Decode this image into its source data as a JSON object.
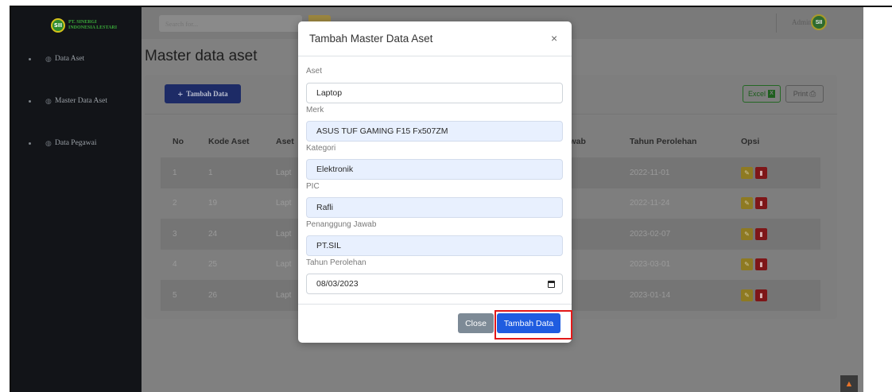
{
  "brand": {
    "logo": "SII",
    "line1": "PT. SINERGI",
    "line2": "INDONESIA LESTARI"
  },
  "sidebar": {
    "items": [
      {
        "label": "Data Aset",
        "icon": "palette-icon"
      },
      {
        "label": "Master Data Aset",
        "icon": "palette-icon"
      },
      {
        "label": "Data Pegawai",
        "icon": "palette-icon"
      }
    ]
  },
  "topbar": {
    "search_placeholder": "Search for...",
    "user_name": "Admin",
    "avatar": "SII"
  },
  "page": {
    "title": "Master data aset"
  },
  "toolbar": {
    "add_label": "Tambah Data",
    "excel_label": "Excel",
    "print_label": "Print"
  },
  "table": {
    "headers": [
      "No",
      "Kode Aset",
      "Aset",
      "ng jawab",
      "Tahun Perolehan",
      "Opsi"
    ],
    "rows": [
      {
        "no": "1",
        "kode": "1",
        "aset": "Lapt",
        "tahun": "2022-11-01"
      },
      {
        "no": "2",
        "kode": "19",
        "aset": "Lapt",
        "tahun": "2022-11-24"
      },
      {
        "no": "3",
        "kode": "24",
        "aset": "Lapt",
        "tahun": "2023-02-07"
      },
      {
        "no": "4",
        "kode": "25",
        "aset": "Lapt",
        "tahun": "2023-03-01"
      },
      {
        "no": "5",
        "kode": "26",
        "aset": "Lapt",
        "tahun": "2023-01-14"
      }
    ]
  },
  "modal": {
    "title": "Tambah Master Data Aset",
    "close_symbol": "×",
    "fields": [
      {
        "label": "Aset",
        "value": "Laptop"
      },
      {
        "label": "Merk",
        "value": "ASUS TUF GAMING F15 Fx507ZM"
      },
      {
        "label": "Kategori",
        "value": "Elektronik"
      },
      {
        "label": "PIC",
        "value": "Rafli"
      },
      {
        "label": "Penanggung Jawab",
        "value": "PT.SIL"
      },
      {
        "label": "Tahun Perolehan",
        "value": "08/03/2023"
      }
    ],
    "close_button": "Close",
    "submit_button": "Tambah Data"
  },
  "colors": {
    "highlight": "#e21818",
    "primary": "#1f5ce0",
    "sidebar": "#121418"
  }
}
